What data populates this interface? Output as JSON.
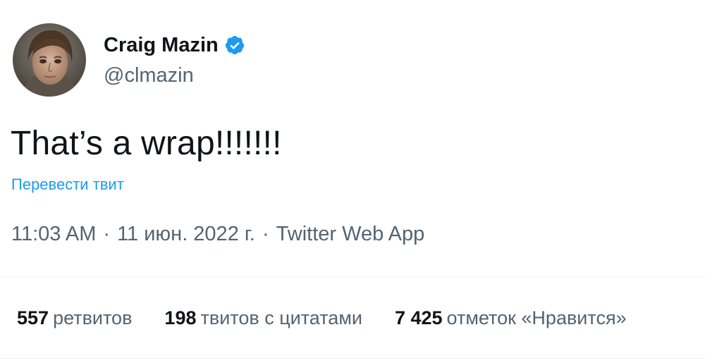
{
  "author": {
    "display_name": "Craig Mazin",
    "handle": "@clmazin",
    "verified": true,
    "avatar_icon": "profile-photo-avatar"
  },
  "tweet": {
    "text": "That’s a wrap!!!!!!!",
    "translate_label": "Перевести твит"
  },
  "meta": {
    "time": "11:03 AM",
    "separator": "·",
    "date": "11 июн. 2022 г.",
    "source": "Twitter Web App"
  },
  "stats": [
    {
      "count": "557",
      "label": "ретвитов"
    },
    {
      "count": "198",
      "label": "твитов с цитатами"
    },
    {
      "count": "7 425",
      "label": "отметок «Нравится»"
    }
  ],
  "colors": {
    "text_primary": "#0f1419",
    "text_secondary": "#536471",
    "link": "#1d9bf0",
    "verified_badge": "#1d9bf0",
    "divider": "#eff3f4"
  }
}
